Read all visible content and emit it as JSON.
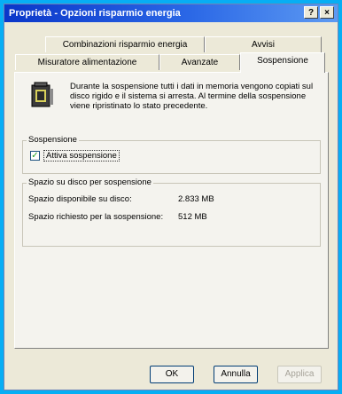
{
  "window": {
    "title": "Proprietà - Opzioni risparmio energia",
    "help_btn": "?",
    "close_btn": "×"
  },
  "tabs": {
    "row1": [
      {
        "label": "Combinazioni risparmio energia"
      },
      {
        "label": "Avvisi"
      }
    ],
    "row2": [
      {
        "label": "Misuratore alimentazione"
      },
      {
        "label": "Avanzate"
      },
      {
        "label": "Sospensione",
        "active": true
      }
    ]
  },
  "hibernate": {
    "description": "Durante la sospensione tutti i dati in memoria vengono copiati sul disco rigido e il sistema si arresta. Al termine della sospensione viene ripristinato lo stato precedente.",
    "group_title": "Sospensione",
    "enable_label": "Attiva sospensione",
    "enabled": true,
    "check_mark": "✓"
  },
  "disk_space": {
    "group_title": "Spazio su disco per sospensione",
    "free_label": "Spazio disponibile su disco:",
    "free_value": "2.833 MB",
    "required_label": "Spazio richiesto per la sospensione:",
    "required_value": "512 MB"
  },
  "buttons": {
    "ok": "OK",
    "cancel": "Annulla",
    "apply": "Applica"
  },
  "colors": {
    "desktop": "#07aef4",
    "titlebar": "#0a36c9",
    "dialog": "#ece9d8"
  }
}
